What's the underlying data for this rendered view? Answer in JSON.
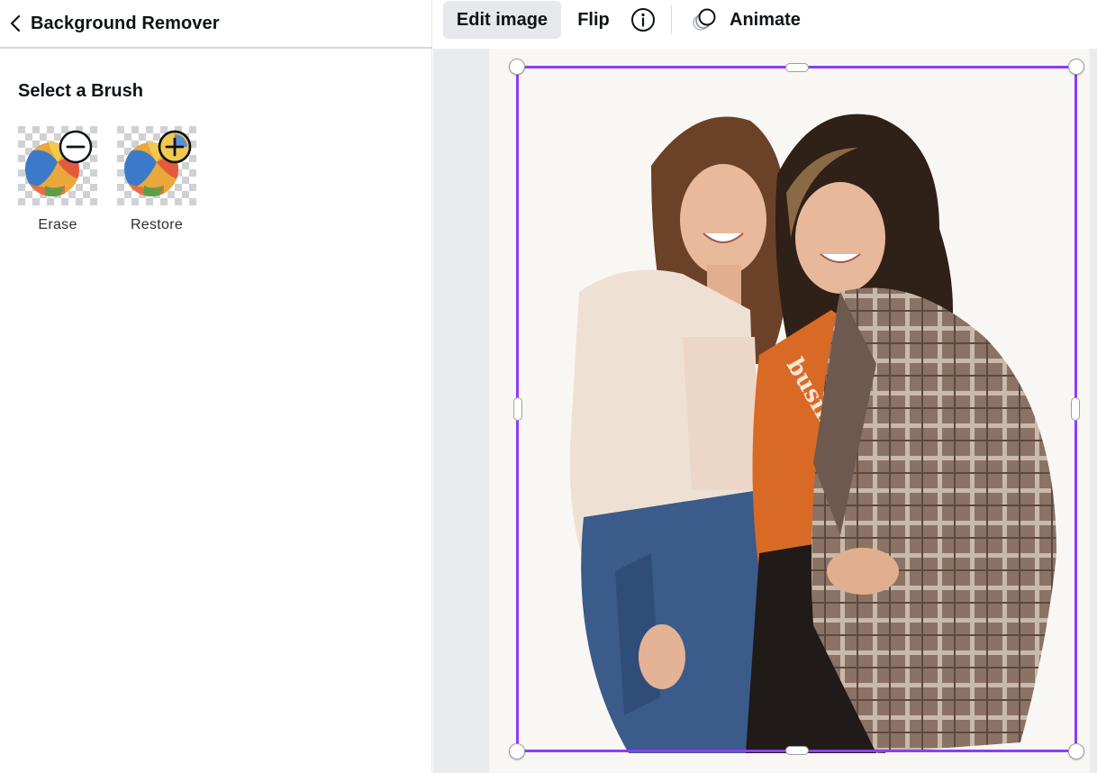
{
  "panel": {
    "title": "Background Remover",
    "section_title": "Select a Brush",
    "brushes": [
      {
        "label": "Erase",
        "icon": "erase-brush-icon"
      },
      {
        "label": "Restore",
        "icon": "restore-brush-icon"
      }
    ]
  },
  "toolbar": {
    "edit_image_label": "Edit image",
    "flip_label": "Flip",
    "info_icon": "info-icon",
    "animate_label": "Animate",
    "animate_icon": "animate-icon"
  },
  "canvas": {
    "image_icon": "photo-two-women",
    "selection_color": "#8b3dff"
  },
  "colors": {
    "accent": "#8b3dff",
    "toolbar_active_bg": "#e6e8eb",
    "canvas_bg": "#e9ebee",
    "page_bg": "#f8f7f3"
  }
}
